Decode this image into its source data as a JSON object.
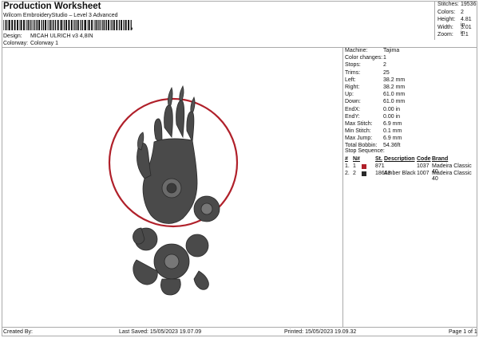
{
  "header": {
    "title": "Production Worksheet",
    "subtitle": "Wilcom EmbroideryStudio – Level 3 Advanced",
    "barcode_comma": ","
  },
  "design": {
    "label": "Design:",
    "value": "MICAH ULRICH v3 4,8IN"
  },
  "colorway": {
    "label": "Colorway:",
    "value": "Colorway 1"
  },
  "stats": [
    {
      "label": "Stitches:",
      "value": "19536"
    },
    {
      "label": "Colors:",
      "value": "2"
    },
    {
      "label": "Height:",
      "value": "4.81 in"
    },
    {
      "label": "Width:",
      "value": "3.01 in"
    },
    {
      "label": "Zoom:",
      "value": "1:1"
    }
  ],
  "info": [
    {
      "label": "Machine:",
      "value": "Tajima"
    },
    {
      "label": "Color changes:",
      "value": "1"
    },
    {
      "label": "Stops:",
      "value": "2"
    },
    {
      "label": "Trims:",
      "value": "25"
    },
    {
      "label": "Left:",
      "value": "38.2 mm"
    },
    {
      "label": "Right:",
      "value": "38.2 mm"
    },
    {
      "label": "Up:",
      "value": "61.0 mm"
    },
    {
      "label": "Down:",
      "value": "61.0 mm"
    },
    {
      "label": "EndX:",
      "value": "0.00 in"
    },
    {
      "label": "EndY:",
      "value": "0.00 in"
    },
    {
      "label": "Max Stitch:",
      "value": "6.9 mm"
    },
    {
      "label": "Min Stitch:",
      "value": "0.1 mm"
    },
    {
      "label": "Max Jump:",
      "value": "6.9 mm"
    },
    {
      "label": "Total Bobbin:",
      "value": "54.36ft"
    }
  ],
  "stop_sequence": {
    "title": "Stop Sequence:",
    "headers": {
      "num": "#",
      "n": "N#",
      "st": "St.",
      "desc": "Description",
      "code": "Code",
      "brand": "Brand"
    },
    "rows": [
      {
        "num": "1.",
        "n": "1",
        "color": "#b0202a",
        "st": "871",
        "desc": "",
        "code": "1037",
        "brand": "Madeira Classic 40"
      },
      {
        "num": "2.",
        "n": "2",
        "color": "#2a2a2a",
        "st": "18663",
        "desc": "Amber Black",
        "code": "1007",
        "brand": "Madeira Classic 40"
      }
    ]
  },
  "footer": {
    "created": "Created By:",
    "saved": "Last Saved: 15/05/2023 19.07.09",
    "printed": "Printed: 15/05/2023 19.09.32",
    "page": "Page 1 of 1"
  },
  "colors": {
    "ring": "#b0202a",
    "thread": "#3a3a3a"
  }
}
